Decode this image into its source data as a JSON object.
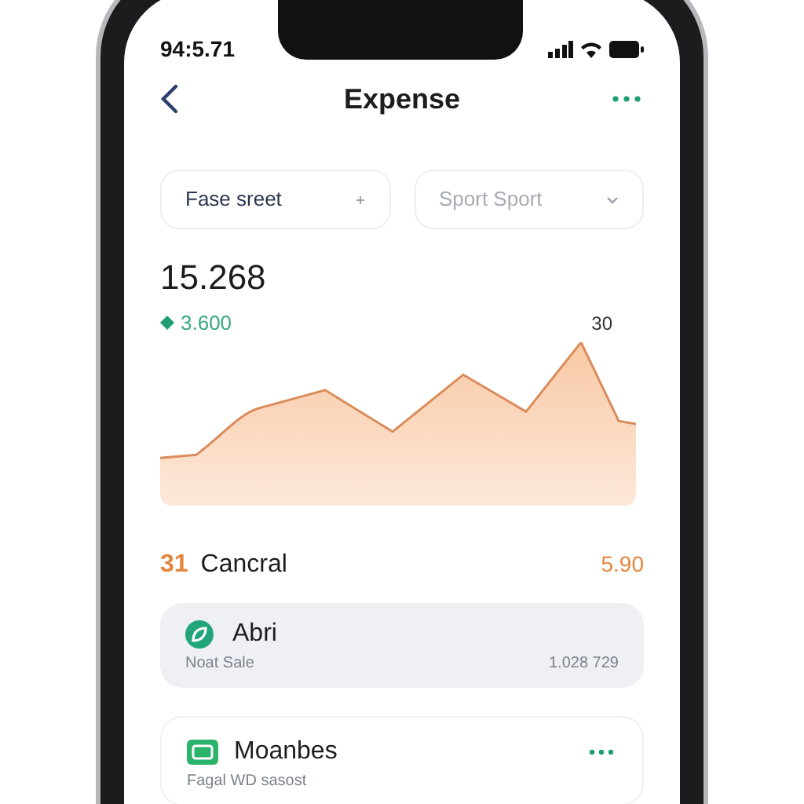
{
  "status_bar": {
    "time": "94:5.71"
  },
  "header": {
    "title": "Expense"
  },
  "filters": [
    {
      "value": "Fase sreet"
    },
    {
      "placeholder": "Sport Sport"
    }
  ],
  "summary": {
    "total": "15.268",
    "change": "3.600",
    "peak_label": "30"
  },
  "section": {
    "count": "31",
    "title": "Cancral",
    "amount": "5.90"
  },
  "cards": [
    {
      "title": "Abri",
      "subtitle": "Noat Sale",
      "value": "1.028 729",
      "selected": true
    },
    {
      "title": "Moanbes",
      "subtitle": "Fagal WD sasost",
      "menu": true,
      "selected": false
    }
  ]
}
